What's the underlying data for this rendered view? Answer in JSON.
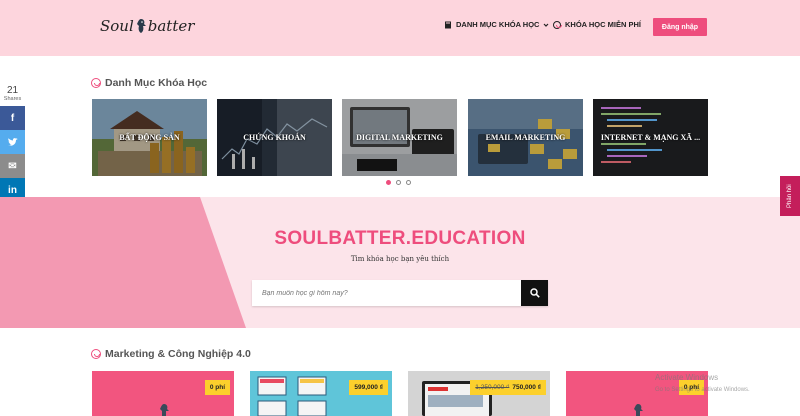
{
  "header": {
    "logo_text_left": "Soul",
    "logo_text_right": "batter",
    "nav_category": "DANH MỤC KHÓA HỌC",
    "nav_free": "KHÓA HỌC MIỄN PHÍ",
    "login": "Đăng nhập"
  },
  "share": {
    "count": "21",
    "label": "Shares",
    "buttons": [
      {
        "name": "facebook",
        "glyph": "f"
      },
      {
        "name": "twitter",
        "glyph": "t"
      },
      {
        "name": "email",
        "glyph": "✉"
      },
      {
        "name": "linkedin",
        "glyph": "in"
      }
    ]
  },
  "categories": {
    "title": "Danh Mục Khóa Học",
    "items": [
      "BẤT ĐỘNG SẢN",
      "CHỨNG KHOÁN",
      "DIGITAL MARKETING",
      "EMAIL MARKETING",
      "INTERNET & MẠNG XÃ ..."
    ],
    "slides": 3,
    "active_slide": 1
  },
  "hero": {
    "title": "SOULBATTER.EDUCATION",
    "subtitle": "Tìm khóa học bạn yêu thích",
    "search_placeholder": "Bạn muốn học gì hôm nay?"
  },
  "feedback": "Phản hồi",
  "courses": {
    "title": "Marketing & Công Nghiệp 4.0",
    "items": [
      {
        "price": "0 phí",
        "old_price": ""
      },
      {
        "price": "599,000 ₫",
        "old_price": ""
      },
      {
        "price": "750,000 ₫",
        "old_price": "1,250,000 ₫"
      },
      {
        "price": "0 phí",
        "old_price": ""
      }
    ]
  },
  "watermark": {
    "line1": "Activate Windows",
    "line2": "Go to Settings to activate Windows."
  },
  "colors": {
    "accent": "#ee4d7d",
    "header_bg": "#fdd5dd",
    "hero_bg": "#fce4ea"
  }
}
